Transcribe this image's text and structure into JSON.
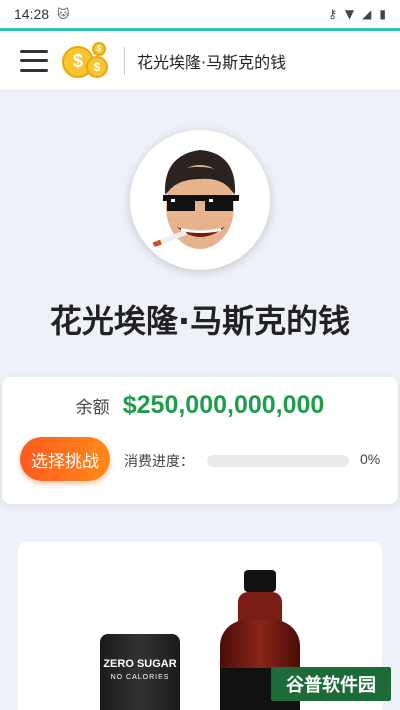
{
  "status_bar": {
    "time": "14:28"
  },
  "header": {
    "title": "花光埃隆·马斯克的钱"
  },
  "hero": {
    "title": "花光埃隆·马斯克的钱"
  },
  "balance": {
    "label": "余额",
    "value": "$250,000,000,000",
    "challenge_button": "选择挑战",
    "progress_label": "消费进度：",
    "progress_percent": "0%",
    "progress_fraction": 0
  },
  "products": {
    "can_text_1": "ZERO SUGAR",
    "can_text_2": "NO CALORIES"
  },
  "watermark": {
    "text": "谷普软件园"
  },
  "colors": {
    "accent_teal": "#2bc4b0",
    "balance_green": "#1e9e4a",
    "button_orange": "#ff6a1e"
  }
}
